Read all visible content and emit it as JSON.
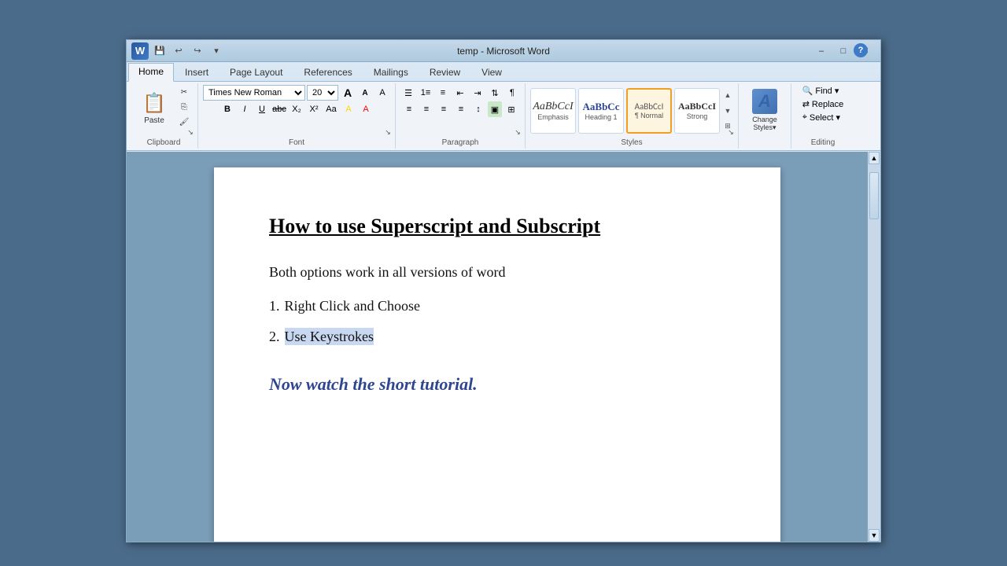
{
  "window": {
    "title": "temp - Microsoft Word"
  },
  "titlebar": {
    "app_name": "W",
    "min_btn": "–",
    "max_btn": "□",
    "close_btn": "✕"
  },
  "ribbon": {
    "tabs": [
      "Home",
      "Insert",
      "Page Layout",
      "References",
      "Mailings",
      "Review",
      "View"
    ],
    "active_tab": "Home",
    "font": {
      "name": "Times New Roman",
      "size": "20",
      "grow_label": "A",
      "shrink_label": "a",
      "clear_label": "A",
      "bold": "B",
      "italic": "I",
      "underline": "U",
      "strikethrough": "abc",
      "subscript": "X₂",
      "superscript": "X²",
      "case": "Aa",
      "highlight": "A",
      "color": "A"
    },
    "paragraph": {
      "label": "Paragraph"
    },
    "styles": {
      "label": "Styles",
      "items": [
        {
          "name": "Emphasis",
          "preview": "AaBbCcI",
          "style": "emphasis"
        },
        {
          "name": "Heading 1",
          "preview": "AaBbCc",
          "style": "heading1"
        },
        {
          "name": "Normal",
          "preview": "AaBbCcI",
          "style": "normal",
          "active": true
        },
        {
          "name": "Strong",
          "preview": "AaBbCcI",
          "style": "strong"
        }
      ]
    },
    "editing": {
      "label": "Editing",
      "find_label": "Find ▾",
      "replace_label": "Replace",
      "select_label": "Select ▾"
    },
    "groups": {
      "clipboard": "Clipboard",
      "font": "Font",
      "paragraph": "Paragraph",
      "styles": "Styles",
      "editing": "Editing"
    }
  },
  "document": {
    "heading": "How to use Superscript and Subscript",
    "para1": "Both options work in all versions of word",
    "list_item1": "Right Click and Choose",
    "list_item1_num": "1.",
    "list_item2": "Use Keystrokes",
    "list_item2_num": "2.",
    "tutorial": "Now watch the short tutorial."
  }
}
